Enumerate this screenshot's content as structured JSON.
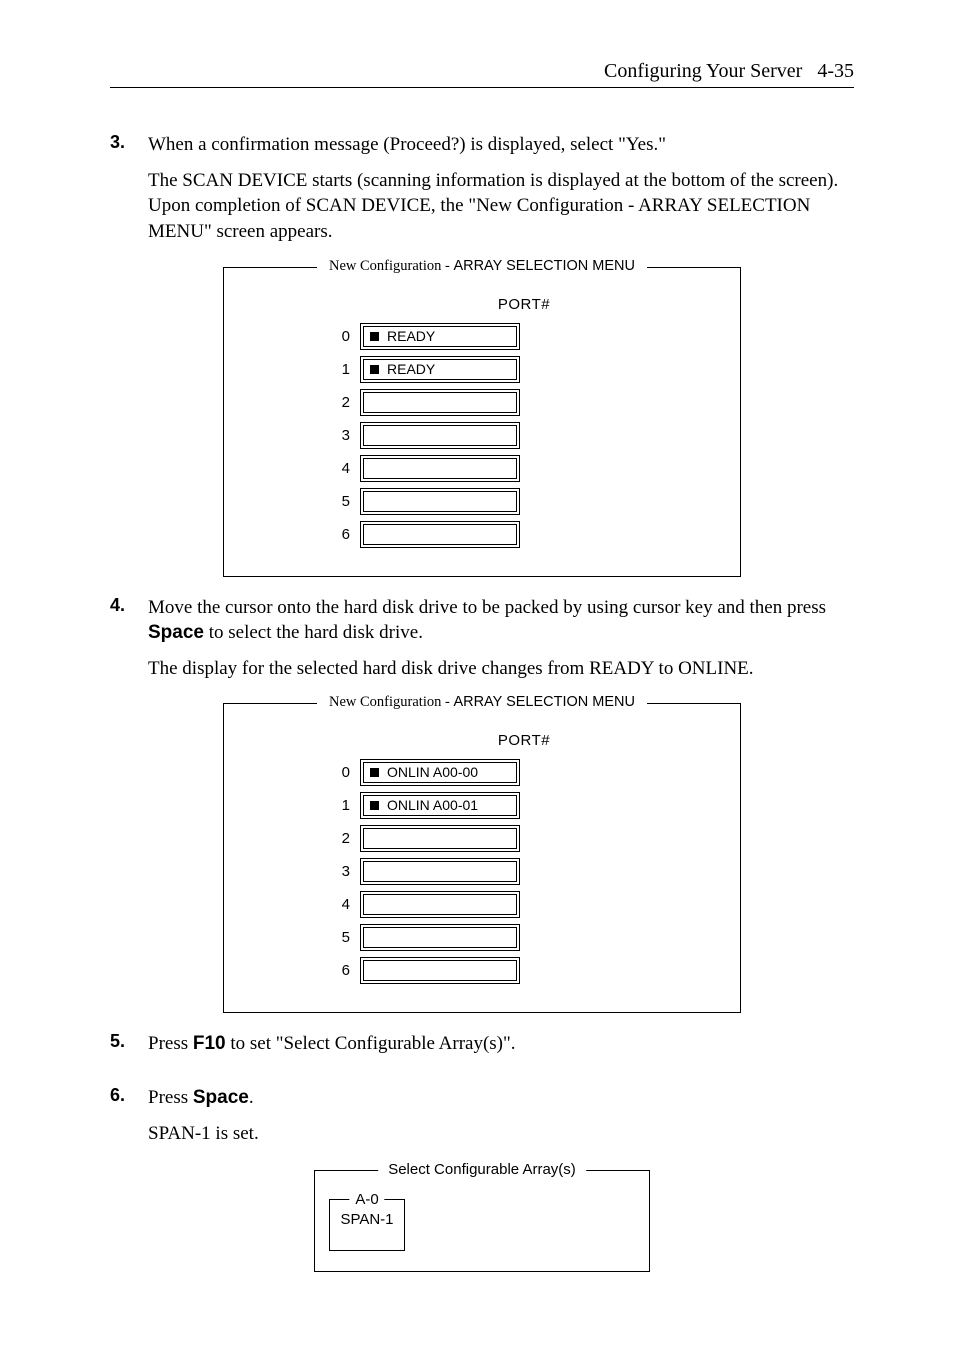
{
  "header": {
    "title": "Configuring Your Server",
    "page_num": "4-35"
  },
  "steps": {
    "s3": {
      "num": "3.",
      "p1": "When a confirmation message (Proceed?) is displayed, select \"Yes.\"",
      "p2": "The SCAN DEVICE starts (scanning information is displayed at the bottom of the screen). Upon completion of SCAN DEVICE, the \"New Configuration - ARRAY SELECTION MENU\" screen appears."
    },
    "s4": {
      "num": "4.",
      "p1a": "Move the cursor onto the hard disk drive to be packed by using cursor key and then press ",
      "space_label": "Space",
      "p1b": " to select the hard disk drive.",
      "p2": "The display for the selected hard disk drive changes from READY to ONLINE."
    },
    "s5": {
      "num": "5.",
      "p1a": "Press ",
      "f10_label": "F10",
      "p1b": " to set \"Select Configurable Array(s)\"."
    },
    "s6": {
      "num": "6.",
      "p1a": "Press ",
      "space_label": "Space",
      "p1b": ".",
      "p2": "SPAN-1 is set."
    }
  },
  "fig_common": {
    "title_a": "New Configuration - ",
    "title_b": "ARRAY SELECTION MENU",
    "port_label": "PORT#"
  },
  "fig1": {
    "rows": [
      {
        "idx": "0",
        "label": "READY",
        "filled": true
      },
      {
        "idx": "1",
        "label": "READY",
        "filled": true
      },
      {
        "idx": "2",
        "label": "",
        "filled": false
      },
      {
        "idx": "3",
        "label": "",
        "filled": false
      },
      {
        "idx": "4",
        "label": "",
        "filled": false
      },
      {
        "idx": "5",
        "label": "",
        "filled": false
      },
      {
        "idx": "6",
        "label": "",
        "filled": false
      }
    ]
  },
  "fig2": {
    "rows": [
      {
        "idx": "0",
        "label": "ONLIN A00-00",
        "filled": true
      },
      {
        "idx": "1",
        "label": "ONLIN A00-01",
        "filled": true
      },
      {
        "idx": "2",
        "label": "",
        "filled": false
      },
      {
        "idx": "3",
        "label": "",
        "filled": false
      },
      {
        "idx": "4",
        "label": "",
        "filled": false
      },
      {
        "idx": "5",
        "label": "",
        "filled": false
      },
      {
        "idx": "6",
        "label": "",
        "filled": false
      }
    ]
  },
  "fig3": {
    "outer_label": "Select Configurable Array(s)",
    "inner_label": "A-0",
    "inner_value": "SPAN-1"
  }
}
